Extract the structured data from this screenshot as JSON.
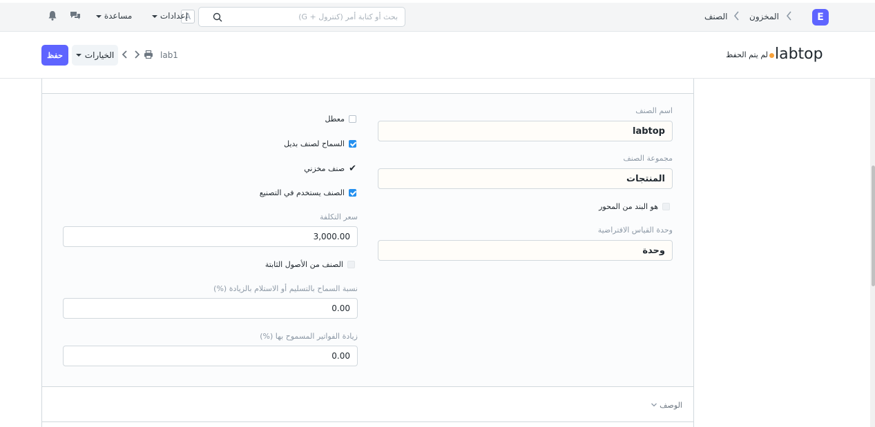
{
  "navbar": {
    "brand_letter": "E",
    "breadcrumbs": [
      "المخزون",
      "الصنف"
    ],
    "search_placeholder": "بحث أو كتابة أمر (كنترول + G)",
    "avatar_letter": "A",
    "settings_label": "إعدادات",
    "help_label": "مساعدة",
    "icons": [
      "bell-icon",
      "chat-icon",
      "search-icon"
    ]
  },
  "page": {
    "title": "labtop",
    "status": "لم يتم الحفظ",
    "status_color": "#f8a23c",
    "doc_name": "lab1",
    "save_label": "حفظ",
    "options_label": "الخيارات"
  },
  "form": {
    "item_name_label": "اسم الصنف",
    "item_name_value": "labtop",
    "item_group_label": "مجموعة الصنف",
    "item_group_value": "المنتجات",
    "is_pivot_label": "هو البند من المحور",
    "uom_label": "وحدة القياس الافتراضية",
    "uom_value": "وحدة",
    "disabled_label": "معطل",
    "allow_alternative_label": "السماح لصنف بديل",
    "stock_item_label": "صنف مخزني",
    "manufacturing_label": "الصنف يستخدم في التصنيع",
    "valuation_rate_label": "سعر التكلفة",
    "valuation_rate_value": "3,000.00",
    "fixed_asset_label": "الصنف من الأصول الثابتة",
    "over_delivery_label": "نسبة السماح بالتسليم أو الاستلام بالزيادة (%)",
    "over_delivery_value": "0.00",
    "over_billing_label": "زيادة الفواتير المسموح بها (%)",
    "over_billing_value": "0.00",
    "description_section_label": "الوصف"
  },
  "checkboxes": {
    "disabled": false,
    "allow_alternative": true,
    "stock_item": true,
    "manufacturing": true,
    "fixed_asset": false,
    "is_pivot": false
  },
  "colors": {
    "primary": "#5e64ff",
    "checkbox": "#2490ef"
  }
}
